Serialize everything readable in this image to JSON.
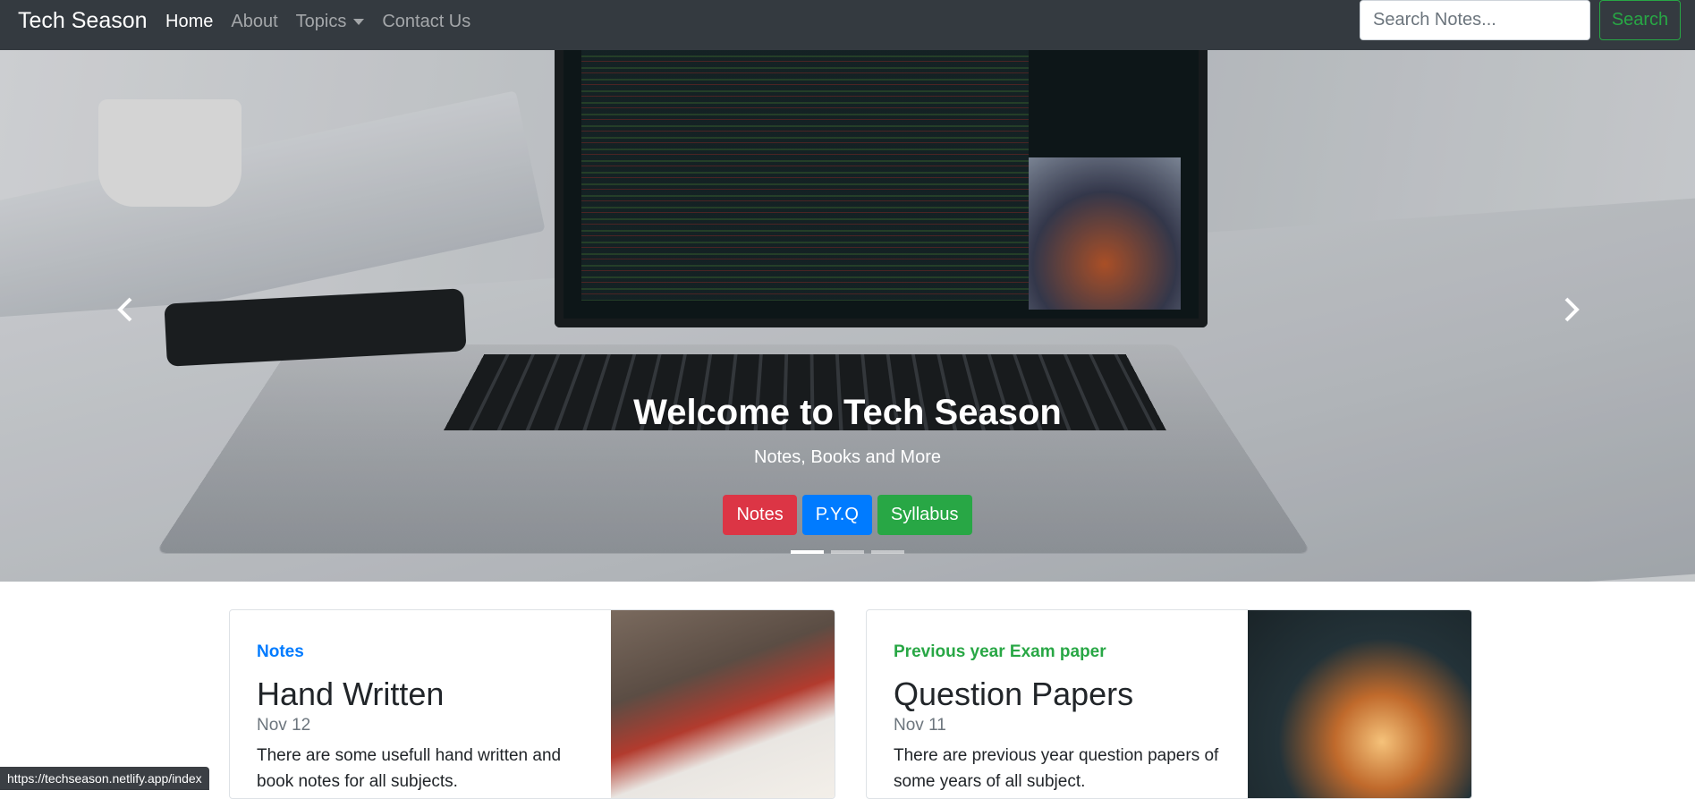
{
  "navbar": {
    "brand": "Tech Season",
    "links": {
      "home": "Home",
      "about": "About",
      "topics": "Topics",
      "contact": "Contact Us"
    },
    "search": {
      "placeholder": "Search Notes...",
      "button": "Search"
    }
  },
  "hero": {
    "title": "Welcome to Tech Season",
    "subtitle": "Notes, Books and More",
    "buttons": {
      "notes": "Notes",
      "pyq": "P.Y.Q",
      "syllabus": "Syllabus"
    },
    "slide_count": 3,
    "active_slide": 1
  },
  "cards": [
    {
      "tag": "Notes",
      "title": "Hand Written",
      "date": "Nov 12",
      "desc": "There are some usefull hand written and book notes for all subjects."
    },
    {
      "tag": "Previous year Exam paper",
      "title": "Question Papers",
      "date": "Nov 11",
      "desc": "There are previous year question papers of some years of all subject."
    }
  ],
  "status_bar": {
    "url": "https://techseason.netlify.app/index"
  },
  "colors": {
    "navbar": "#343a40",
    "red": "#dc3545",
    "blue": "#007bff",
    "green": "#28a745"
  }
}
